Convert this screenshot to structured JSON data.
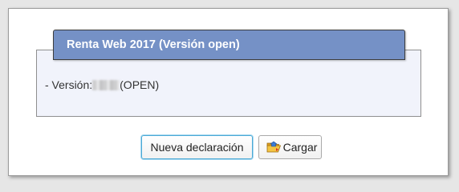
{
  "panel": {
    "title": "Renta Web 2017 (Versión open)",
    "version_prefix": "- Versión:",
    "version_suffix": "(OPEN)"
  },
  "buttons": {
    "new_declaration": "Nueva declaración",
    "load": "Cargar",
    "load_icon": "folder-open-icon"
  },
  "colors": {
    "header_bg": "#7591c6",
    "panel_bg": "#f1f3fb",
    "focus_border": "#4aa9d6"
  }
}
